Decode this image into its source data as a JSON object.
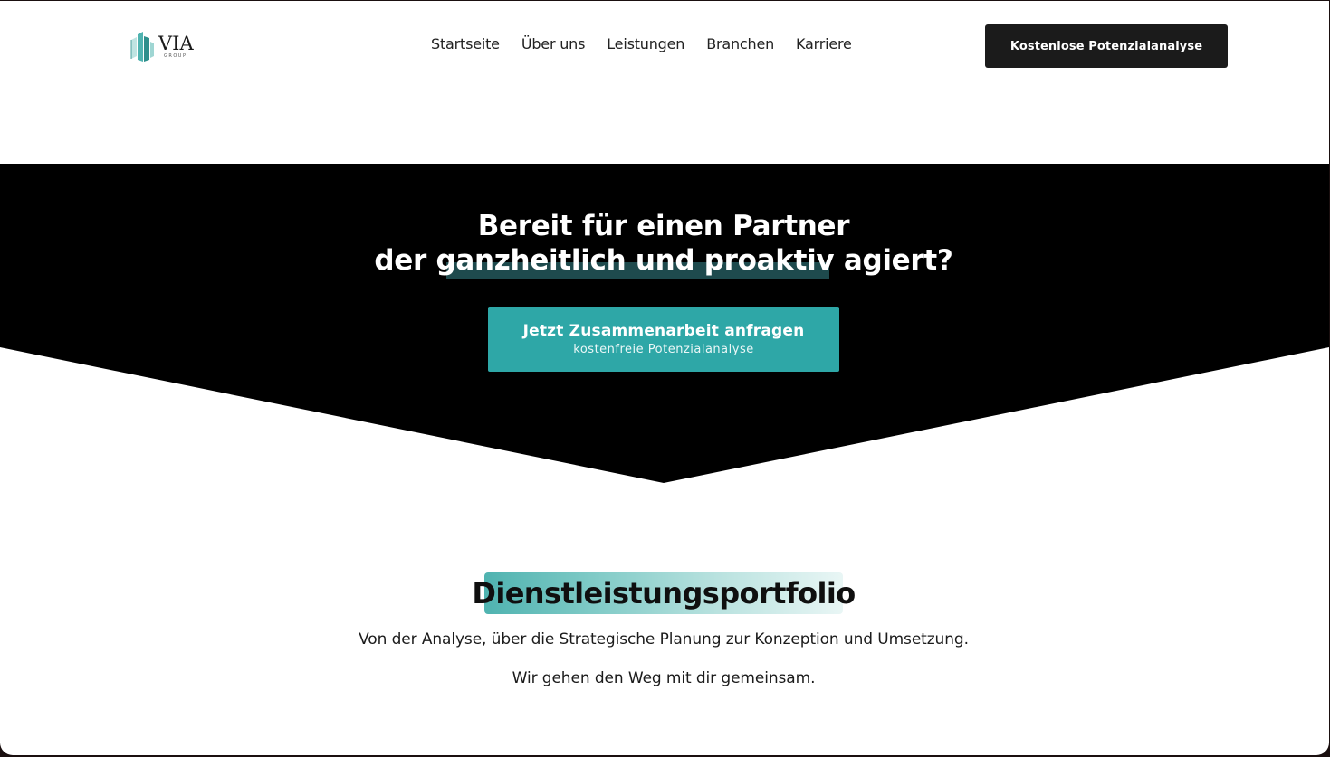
{
  "brand": {
    "name": "VIA",
    "sub": "GROUP",
    "accent": "#2ea7a7"
  },
  "nav": {
    "items": [
      {
        "label": "Startseite"
      },
      {
        "label": "Über uns"
      },
      {
        "label": "Leistungen"
      },
      {
        "label": "Branchen"
      },
      {
        "label": "Karriere"
      }
    ],
    "cta_label": "Kostenlose Potenzialanalyse"
  },
  "hero": {
    "title_line1": "Bereit für einen Partner",
    "title_line2": "der ganzheitlich und proaktiv agiert?",
    "cta_main": "Jetzt Zusammenarbeit anfragen",
    "cta_sub": "kostenfreie Potenzialanalyse"
  },
  "portfolio": {
    "title": "Dienstleistungsportfolio",
    "line1": "Von der Analyse, über die Strategische Planung zur Konzeption und Umsetzung.",
    "line2": "Wir gehen den Weg mit dir gemeinsam."
  }
}
